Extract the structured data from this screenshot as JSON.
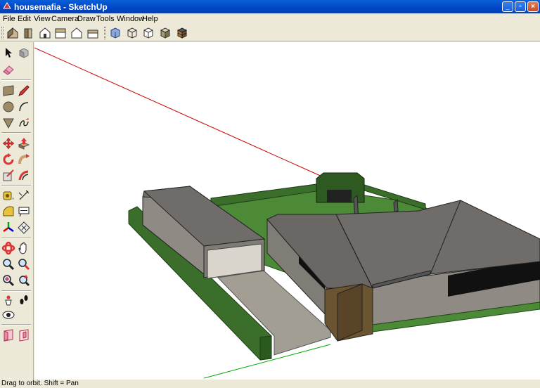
{
  "window": {
    "title": "housemafia - SketchUp",
    "buttons": {
      "minimize": "_",
      "maximize": "▫",
      "close": "×"
    }
  },
  "menu": {
    "items": [
      "File",
      "Edit",
      "View",
      "Camera",
      "Draw",
      "Tools",
      "Window",
      "Help"
    ]
  },
  "toolbar": {
    "view_icons": [
      "iso-view-icon",
      "top-view-icon",
      "front-view-icon",
      "right-view-icon",
      "back-view-icon",
      "left-view-icon"
    ],
    "style_icons": [
      "xray-style-icon",
      "wireframe-style-icon",
      "hidden-line-style-icon",
      "shaded-style-icon",
      "shaded-textures-style-icon"
    ]
  },
  "left_toolbar": {
    "tools": [
      "select-icon",
      "make-component-icon",
      "eraser-icon",
      "rectangle-icon",
      "pencil-icon",
      "circle-icon",
      "arc-icon",
      "polygon-icon",
      "freehand-icon",
      "move-icon",
      "push-pull-icon",
      "rotate-icon",
      "follow-me-icon",
      "scale-icon",
      "offset-icon",
      "tape-measure-icon",
      "dimension-icon",
      "protractor-icon",
      "text-icon",
      "axes-icon",
      "3d-text-icon",
      "orbit-icon",
      "pan-icon",
      "zoom-icon",
      "zoom-window-icon",
      "zoom-extents-icon",
      "previous-view-icon",
      "position-camera-icon",
      "walk-icon",
      "look-around-icon",
      "section-plane-icon",
      "section-display-icon"
    ]
  },
  "status": {
    "text": "Drag to orbit.  Shift = Pan"
  },
  "colors": {
    "title_bar": "#0a4fd0",
    "chrome": "#ece9d8",
    "hedge": "#3a6e2a",
    "lawn": "#4c8a38",
    "roof": "#6f6c69",
    "wall": "#8f8b84",
    "axis_red": "#cc0000",
    "axis_green": "#00aa00"
  }
}
